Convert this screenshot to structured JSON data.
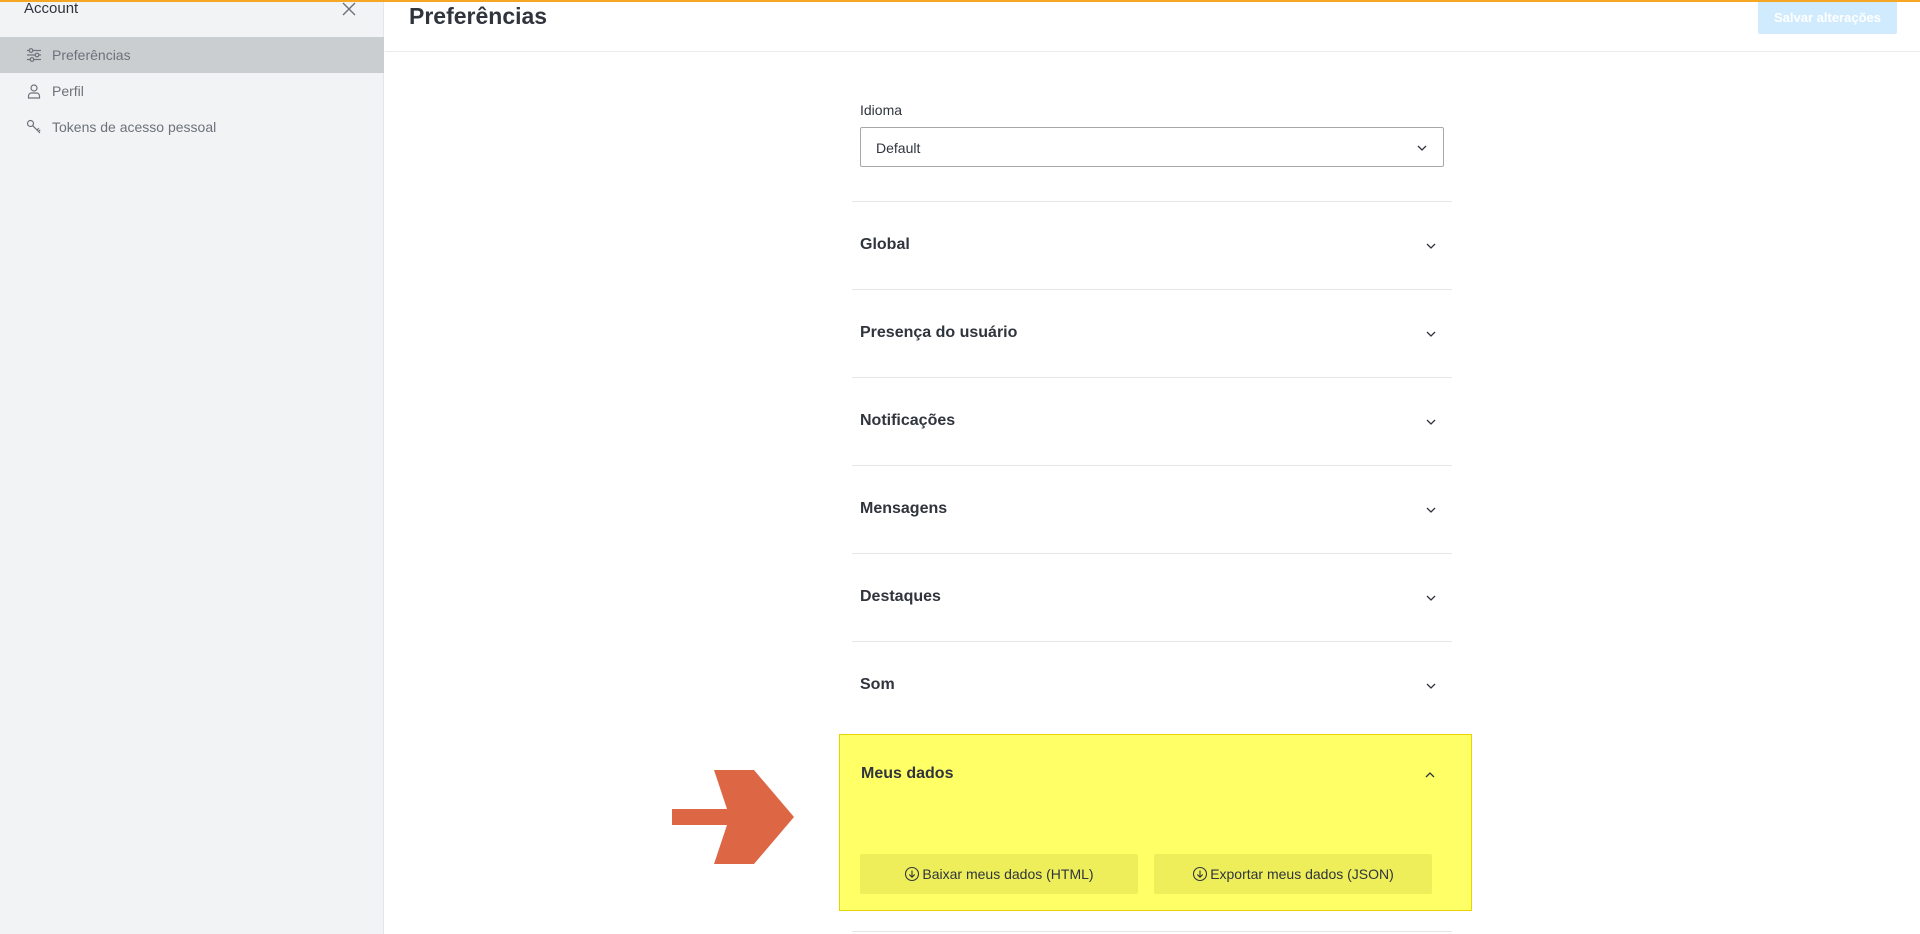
{
  "sidebar": {
    "title": "Account",
    "items": [
      {
        "label": "Preferências",
        "icon": "sliders-icon",
        "active": true
      },
      {
        "label": "Perfil",
        "icon": "user-icon",
        "active": false
      },
      {
        "label": "Tokens de acesso pessoal",
        "icon": "key-icon",
        "active": false
      }
    ]
  },
  "header": {
    "title": "Preferências",
    "save_label": "Salvar alterações"
  },
  "language": {
    "label": "Idioma",
    "value": "Default"
  },
  "sections": [
    {
      "title": "Global"
    },
    {
      "title": "Presença do usuário"
    },
    {
      "title": "Notificações"
    },
    {
      "title": "Mensagens"
    },
    {
      "title": "Destaques"
    },
    {
      "title": "Som"
    }
  ],
  "my_data": {
    "title": "Meus dados",
    "download_html_label": "Baixar meus dados (HTML)",
    "export_json_label": "Exportar meus dados (JSON)"
  },
  "colors": {
    "accent_top_line": "#f5a623",
    "highlight": "#ffff66",
    "arrow": "#dd6644",
    "save_button_bg": "#d1ebfe",
    "sidebar_active": "#cbced1"
  }
}
